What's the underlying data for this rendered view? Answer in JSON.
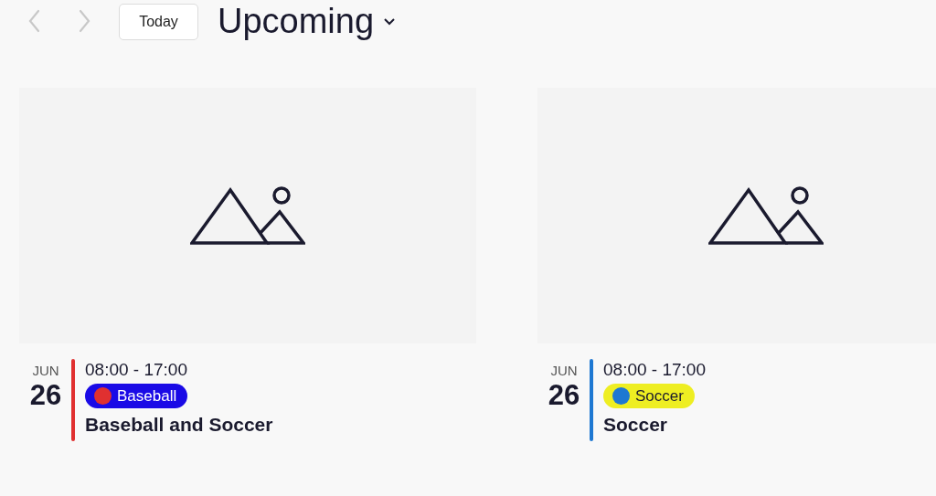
{
  "toolbar": {
    "prev": {
      "disabled": true
    },
    "next": {
      "disabled": true
    },
    "today_button": "Today",
    "view_title": "Upcoming"
  },
  "events": [
    {
      "month": "JUN",
      "day": "26",
      "time": "08:00 - 17:00",
      "color": "#e03030",
      "tag": {
        "label": "Baseball",
        "color": "#1a0ae6"
      },
      "title": "Baseball and Soccer"
    },
    {
      "month": "JUN",
      "day": "26",
      "time": "08:00 - 17:00",
      "color": "#1e78d2",
      "tag": {
        "label": "Soccer",
        "color": "#eeee22"
      },
      "title": "Soccer"
    }
  ]
}
